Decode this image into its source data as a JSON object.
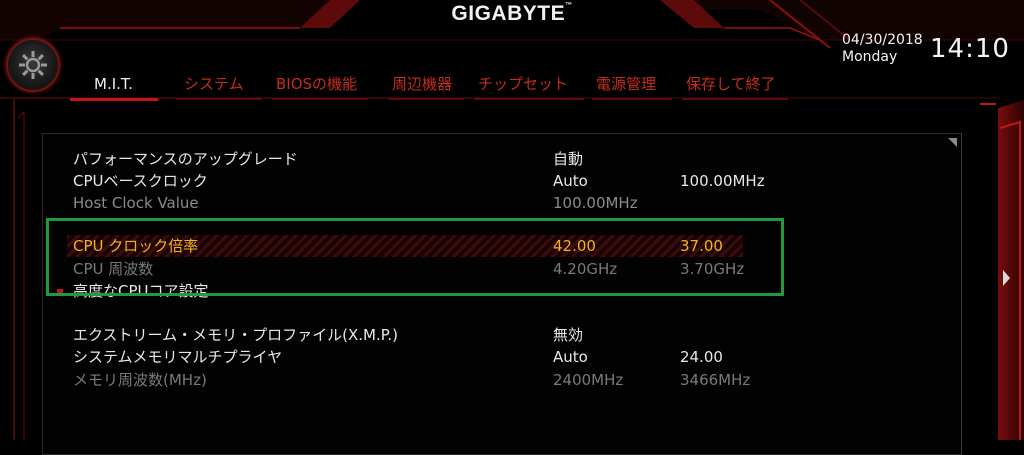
{
  "header": {
    "brand": "GIGABYTE",
    "trademark": "™",
    "date": "04/30/2018",
    "weekday": "Monday",
    "time": "14:10"
  },
  "tabs": [
    {
      "label": "M.I.T.",
      "active": true
    },
    {
      "label": "システム",
      "active": false
    },
    {
      "label": "BIOSの機能",
      "active": false
    },
    {
      "label": "周辺機器",
      "active": false
    },
    {
      "label": "チップセット",
      "active": false
    },
    {
      "label": "電源管理",
      "active": false
    },
    {
      "label": "保存して終了",
      "active": false
    }
  ],
  "settings": {
    "perf_upgrade": {
      "label": "パフォーマンスのアップグレード",
      "value": "自動"
    },
    "cpu_base_clock": {
      "label": "CPUベースクロック",
      "value": "Auto",
      "value2": "100.00MHz"
    },
    "host_clock": {
      "label": "Host Clock Value",
      "value": "100.00MHz"
    },
    "cpu_ratio": {
      "label": "CPU クロック倍率",
      "value": "42.00",
      "value2": "37.00"
    },
    "cpu_freq": {
      "label": "CPU 周波数",
      "value": "4.20GHz",
      "value2": "3.70GHz"
    },
    "adv_cpu": {
      "label": "高度なCPUコア設定"
    },
    "xmp": {
      "label": "エクストリーム・メモリ・プロファイル(X.M.P.)",
      "value": "無効"
    },
    "mem_multiplier": {
      "label": "システムメモリマルチプライヤ",
      "value": "Auto",
      "value2": "24.00"
    },
    "mem_freq": {
      "label": "メモリ周波数(MHz)",
      "value": "2400MHz",
      "value2": "3466MHz"
    }
  },
  "colors": {
    "accent_red": "#c41414",
    "tab_text": "#c62c1c",
    "selected_text": "#f2b41a",
    "highlight_box": "#1f9a3c"
  }
}
